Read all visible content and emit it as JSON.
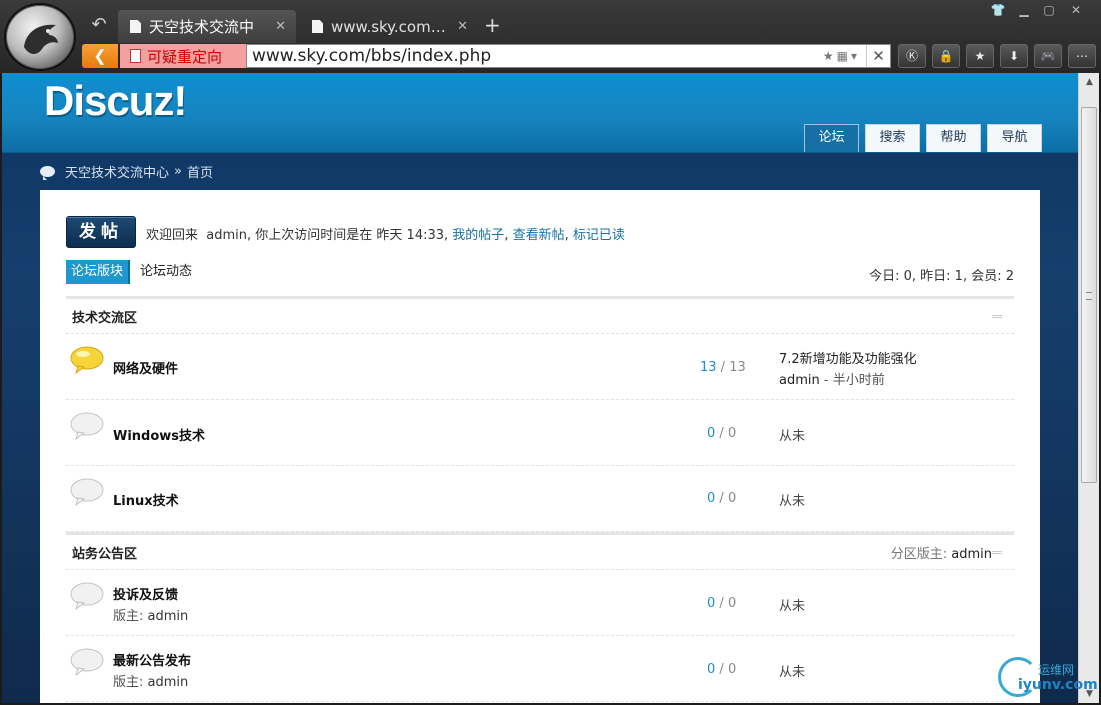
{
  "browser": {
    "tabs": [
      {
        "title": "天空技术交流中",
        "active": true
      },
      {
        "title": "www.sky.com/...",
        "active": false
      }
    ],
    "new_tab": "+",
    "redirect_warning": "可疑重定向",
    "url": "www.sky.com/bbs/index.php",
    "back_arrow": "<"
  },
  "site": {
    "brand": "Discuz!",
    "nav": [
      {
        "label": "论坛",
        "active": true
      },
      {
        "label": "搜索"
      },
      {
        "label": "帮助"
      },
      {
        "label": "导航"
      }
    ]
  },
  "breadcrumb": {
    "home": "天空技术交流中心",
    "sep": "»",
    "current": "首页"
  },
  "main": {
    "post_button": "发帖",
    "welcome_prefix": "欢迎回来",
    "username": "admin",
    "last_visit": ", 你上次访问时间是在 昨天 14:33,",
    "links": [
      "我的帖子",
      "查看新帖",
      "标记已读"
    ],
    "subtabs": [
      "论坛版块",
      "论坛动态"
    ],
    "stats": "今日: 0, 昨日: 1, 会员: 2"
  },
  "categories": [
    {
      "name": "技术交流区",
      "forums": [
        {
          "name": "网络及硬件",
          "topics": "13",
          "posts": "13",
          "last_title": "7.2新增功能及功能强化",
          "last_user": "admin",
          "last_time": "半小时前",
          "new": true
        },
        {
          "name": "Windows技术",
          "topics": "0",
          "posts": "0",
          "last": "从未"
        },
        {
          "name": "Linux技术",
          "topics": "0",
          "posts": "0",
          "last": "从未"
        }
      ]
    },
    {
      "name": "站务公告区",
      "moderator_label": "分区版主:",
      "moderator": "admin",
      "forums": [
        {
          "name": "投诉及反馈",
          "mod_label": "版主:",
          "mod": "admin",
          "topics": "0",
          "posts": "0",
          "last": "从未"
        },
        {
          "name": "最新公告发布",
          "mod_label": "版主:",
          "mod": "admin",
          "topics": "0",
          "posts": "0",
          "last": "从未"
        }
      ]
    }
  ],
  "watermark": {
    "line1": "运维网",
    "line2": "iyunv.com"
  }
}
